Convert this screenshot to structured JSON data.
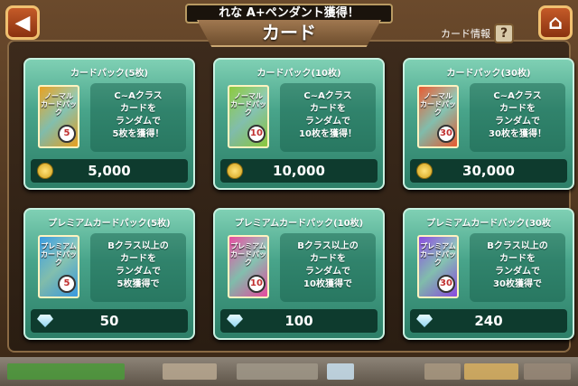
{
  "header": {
    "banner_text": "れな A+ペンダント獲得！",
    "title": "カード",
    "info_label": "カード情報",
    "info_button": "?"
  },
  "nav": {
    "back_icon": "back-arrow-icon",
    "home_icon": "home-icon"
  },
  "cards": [
    {
      "name": "カードパック(5枚)",
      "pack_label": "ノーマル\nカードパック",
      "pack_number": "5",
      "desc": "C~Aクラス\nカードを\nランダムで\n5枚を獲得！",
      "price": "5,000",
      "currency": "coin",
      "pack_color": "#e8a020"
    },
    {
      "name": "カードパック(10枚)",
      "pack_label": "ノーマル\nカードパック",
      "pack_number": "10",
      "desc": "C~Aクラス\nカードを\nランダムで\n10枚を獲得！",
      "price": "10,000",
      "currency": "coin",
      "pack_color": "#8cc83c"
    },
    {
      "name": "カードパック(30枚)",
      "pack_label": "ノーマル\nカードパック",
      "pack_number": "30",
      "desc": "C~Aクラス\nカードを\nランダムで\n30枚を獲得！",
      "price": "30,000",
      "currency": "coin",
      "pack_color": "#e85a30"
    },
    {
      "name": "プレミアムカードパック(5枚)",
      "pack_label": "プレミアム\nカードパック",
      "pack_number": "5",
      "desc": "Bクラス以上の\nカードを\nランダムで\n5枚獲得で",
      "price": "50",
      "currency": "gem",
      "pack_color": "#3a9ae0"
    },
    {
      "name": "プレミアムカードパック(10枚)",
      "pack_label": "プレミアム\nカードパック",
      "pack_number": "10",
      "desc": "Bクラス以上の\nカードを\nランダムで\n10枚獲得で",
      "price": "100",
      "currency": "gem",
      "pack_color": "#e84aa0"
    },
    {
      "name": "プレミアムカードパック(30枚",
      "pack_label": "プレミアム\nカードパック",
      "pack_number": "30",
      "desc": "Bクラス以上の\nカードを\nランダムで\n30枚獲得で",
      "price": "240",
      "currency": "gem",
      "pack_color": "#8a4ae0"
    }
  ],
  "colors": {
    "card_bg": "#48a48a",
    "price_bar": "#0e3b2e",
    "frame": "#4a3320"
  }
}
